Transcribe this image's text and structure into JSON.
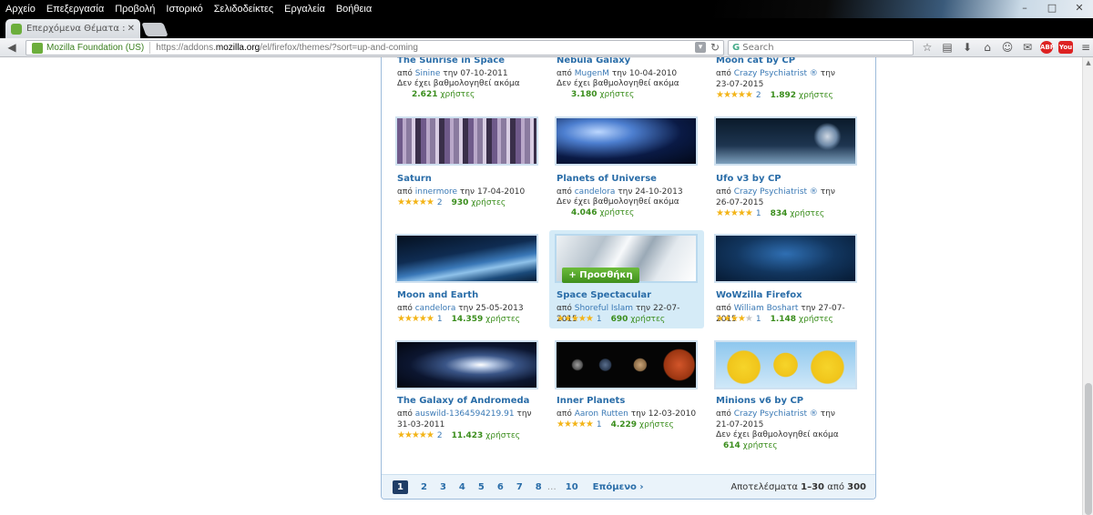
{
  "menu": [
    "Αρχείο",
    "Επεξεργασία",
    "Προβολή",
    "Ιστορικό",
    "Σελιδοδείκτες",
    "Εργαλεία",
    "Βοήθεια"
  ],
  "tab": {
    "title": "Επερχόμενα Θέματα :: Π..."
  },
  "address": {
    "org": "Mozilla Foundation (US)",
    "prefix": "https://addons.",
    "host": "mozilla.org",
    "path": "/el/firefox/themes/?sort=up-and-coming"
  },
  "search": {
    "placeholder": "Search"
  },
  "colors": {
    "link": "#2a6da8",
    "users": "#3a8d1c",
    "accent": "#1f3d66",
    "add_button": "#4e9f27",
    "panel_border": "#9dbbdb"
  },
  "by_label": "από",
  "date_prefix": "την",
  "users_label": "χρήστες",
  "no_rating": "Δεν έχει βαθμολογηθεί ακόμα",
  "add_button": "+ Προσθήκη",
  "themes": [
    {
      "name": "The Sunrise in Space",
      "author": "Sinine",
      "date": "07-10-2011",
      "rating": null,
      "reviews": null,
      "users": "2.621"
    },
    {
      "name": "Nebula Galaxy",
      "author": "MugenM",
      "date": "10-04-2010",
      "rating": null,
      "reviews": null,
      "users": "3.180"
    },
    {
      "name": "Moon cat by CP",
      "author": "Crazy Psychiatrist ®",
      "date": "23-07-2015",
      "rating": 5,
      "reviews": "2",
      "users": "1.892"
    },
    {
      "name": "Saturn",
      "author": "innermore",
      "date": "17-04-2010",
      "rating": 5,
      "reviews": "2",
      "users": "930"
    },
    {
      "name": "Planets of Universe",
      "author": "candelora",
      "date": "24-10-2013",
      "rating": null,
      "reviews": null,
      "users": "4.046"
    },
    {
      "name": "Ufo v3 by CP",
      "author": "Crazy Psychiatrist ®",
      "date": "26-07-2015",
      "rating": 5,
      "reviews": "1",
      "users": "834"
    },
    {
      "name": "Moon and Earth",
      "author": "candelora",
      "date": "25-05-2013",
      "rating": 5,
      "reviews": "1",
      "users": "14.359"
    },
    {
      "name": "Space Spectacular",
      "author": "Shoreful Islam",
      "date": "22-07-2015",
      "rating": 5,
      "reviews": "1",
      "users": "690"
    },
    {
      "name": "WoWzilla Firefox",
      "author": "William Boshart",
      "date": "27-07-2015",
      "rating": 4,
      "reviews": "1",
      "users": "1.148"
    },
    {
      "name": "The Galaxy of Andromeda",
      "author": "auswild-1364594219.91",
      "date": "31-03-2011",
      "rating": 5,
      "reviews": "2",
      "users": "11.423"
    },
    {
      "name": "Inner Planets",
      "author": "Aaron Rutten",
      "date": "12-03-2010",
      "rating": 5,
      "reviews": "1",
      "users": "4.229"
    },
    {
      "name": "Minions v6 by CP",
      "author": "Crazy Psychiatrist ®",
      "date": "21-07-2015",
      "rating": null,
      "reviews": null,
      "users": "614"
    }
  ],
  "pagination": {
    "pages": [
      "1",
      "2",
      "3",
      "4",
      "5",
      "6",
      "7",
      "8"
    ],
    "ellipsis": "…",
    "last": "10",
    "next": "Επόμενο ›",
    "results_prefix": "Αποτελέσματα",
    "range": "1–30",
    "of": "από",
    "total": "300"
  }
}
